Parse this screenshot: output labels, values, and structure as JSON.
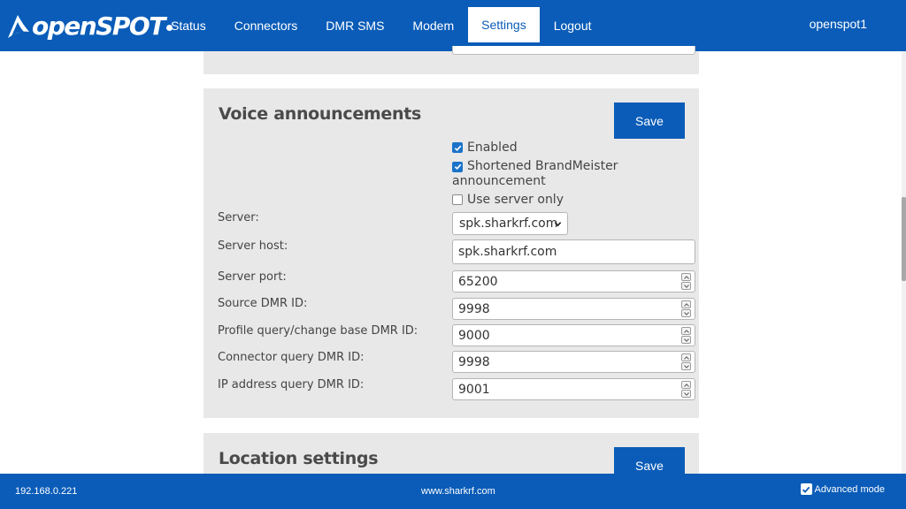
{
  "header": {
    "logo_text": "openSPOT",
    "nav": [
      "Status",
      "Connectors",
      "DMR SMS",
      "Modem",
      "Settings",
      "Logout"
    ],
    "active_nav": "Settings",
    "device_name": "openspot1"
  },
  "voice": {
    "title": "Voice announcements",
    "save_label": "Save",
    "enabled_label": "Enabled",
    "enabled_checked": true,
    "shortened_label": "Shortened BrandMeister announcement",
    "shortened_checked": true,
    "server_only_label": "Use server only",
    "server_only_checked": false,
    "server_label": "Server:",
    "server_value": "spk.sharkrf.com",
    "server_host_label": "Server host:",
    "server_host_value": "spk.sharkrf.com",
    "server_port_label": "Server port:",
    "server_port_value": "65200",
    "source_id_label": "Source DMR ID:",
    "source_id_value": "9998",
    "profile_id_label": "Profile query/change base DMR ID:",
    "profile_id_value": "9000",
    "connector_id_label": "Connector query DMR ID:",
    "connector_id_value": "9998",
    "ip_id_label": "IP address query DMR ID:",
    "ip_id_value": "9001"
  },
  "location": {
    "title": "Location settings",
    "save_label": "Save"
  },
  "footer": {
    "ip": "192.168.0.221",
    "site": "www.sharkrf.com",
    "advanced_label": "Advanced mode",
    "advanced_checked": true
  },
  "colors": {
    "brand_blue": "#0a5cb8",
    "panel_gray": "#e8e8e8",
    "checkbox_blue": "#1a73c9"
  }
}
